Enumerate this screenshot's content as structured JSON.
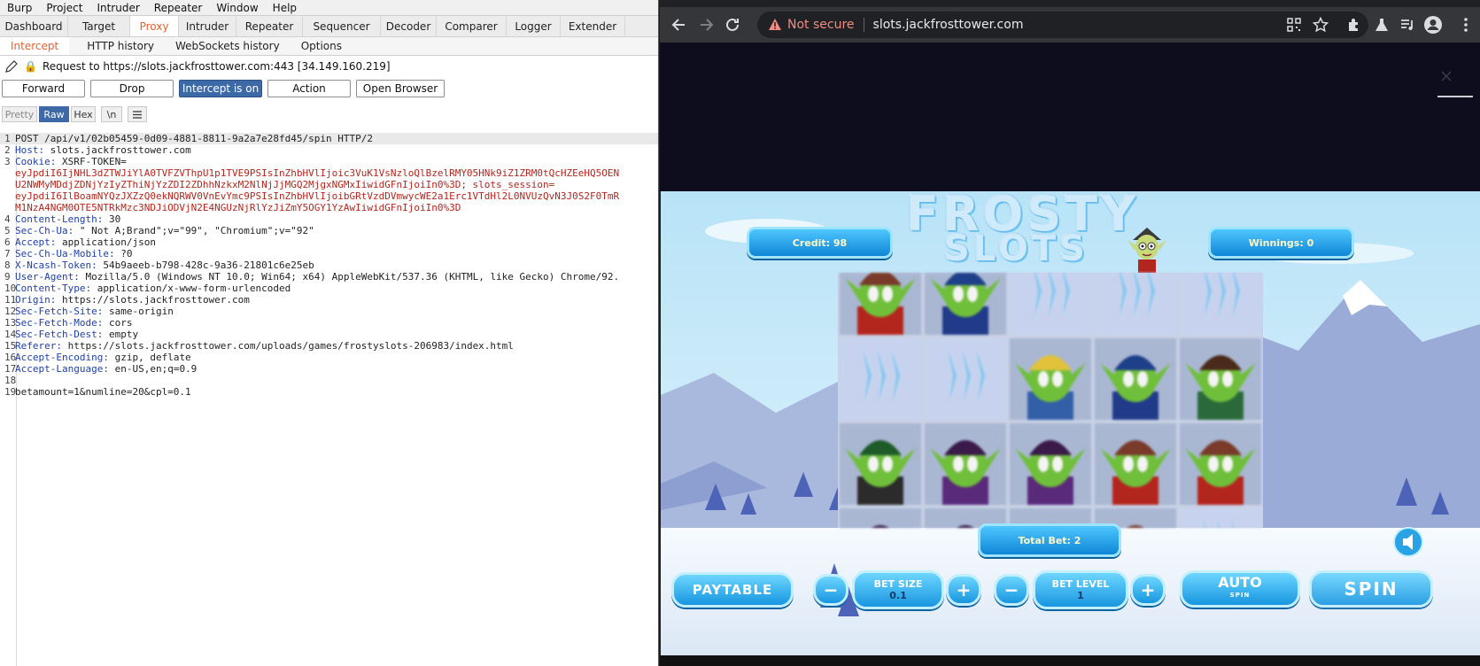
{
  "burp": {
    "menu": [
      "Burp",
      "Project",
      "Intruder",
      "Repeater",
      "Window",
      "Help"
    ],
    "tabs": [
      "Dashboard",
      "Target",
      "Proxy",
      "Intruder",
      "Repeater",
      "Sequencer",
      "Decoder",
      "Comparer",
      "Logger",
      "Extender"
    ],
    "active_tab": "Proxy",
    "subtabs": [
      "Intercept",
      "HTTP history",
      "WebSockets history",
      "Options"
    ],
    "active_subtab": "Intercept",
    "request_target": "Request to https://slots.jackfrosttower.com:443  [34.149.160.219]",
    "buttons": {
      "forward": "Forward",
      "drop": "Drop",
      "intercept": "Intercept is on",
      "action": "Action",
      "open_browser": "Open Browser"
    },
    "view": {
      "pretty": "Pretty",
      "raw": "Raw",
      "hex": "Hex",
      "newline": "\\n",
      "menu_icon": "hamburger-icon"
    },
    "request_lines": [
      {
        "n": "1",
        "k": "",
        "v": "POST /api/v1/02b05459-0d09-4881-8811-9a2a7e28fd45/spin HTTP/2"
      },
      {
        "n": "2",
        "k": "Host",
        "v": " slots.jackfrosttower.com"
      },
      {
        "n": "3",
        "k": "Cookie",
        "v": " XSRF-TOKEN="
      },
      {
        "n": "",
        "k": "",
        "v": "eyJpdiI6IjNHL3dZTWJiYlA0TVFZVThpU1p1TVE9PSIsInZhbHVlIjoic3VuK1VsNzloQlBzelRMY05HNk9iZ1ZRM0tQcHZEeHQ5OEN"
      },
      {
        "n": "",
        "k": "",
        "v": "U2NWMyMDdjZDNjYzIyZThiNjYzZDI2ZDhhNzkxM2NlNjJjMGQ2MjgxNGMxIiwidGFnIjoiIn0%3D; slots_session="
      },
      {
        "n": "",
        "k": "",
        "v": "eyJpdiI6IlBoamNYQzJXZzQ0ekNQRWV0VnEvYmc9PSIsInZhbHVlIjoibGRtVzdDVmwycWE2a1Erc1VTdHl2L0NVUzQvN3J0S2F0TmR"
      },
      {
        "n": "",
        "k": "",
        "v": "M1NzA4NGM0OTE5NTRkMzc3NDJiODVjN2E4NGUzNjRlYzJiZmY5OGY1YzAwIiwidGFnIjoiIn0%3D"
      },
      {
        "n": "4",
        "k": "Content-Length",
        "v": " 30"
      },
      {
        "n": "5",
        "k": "Sec-Ch-Ua",
        "v": " \" Not A;Brand\";v=\"99\", \"Chromium\";v=\"92\""
      },
      {
        "n": "6",
        "k": "Accept",
        "v": " application/json"
      },
      {
        "n": "7",
        "k": "Sec-Ch-Ua-Mobile",
        "v": " ?0"
      },
      {
        "n": "8",
        "k": "X-Ncash-Token",
        "v": " 54b9aeeb-b798-428c-9a36-21801c6e25eb"
      },
      {
        "n": "9",
        "k": "User-Agent",
        "v": " Mozilla/5.0 (Windows NT 10.0; Win64; x64) AppleWebKit/537.36 (KHTML, like Gecko) Chrome/92."
      },
      {
        "n": "10",
        "k": "Content-Type",
        "v": " application/x-www-form-urlencoded"
      },
      {
        "n": "11",
        "k": "Origin",
        "v": " https://slots.jackfrosttower.com"
      },
      {
        "n": "12",
        "k": "Sec-Fetch-Site",
        "v": " same-origin"
      },
      {
        "n": "13",
        "k": "Sec-Fetch-Mode",
        "v": " cors"
      },
      {
        "n": "14",
        "k": "Sec-Fetch-Dest",
        "v": " empty"
      },
      {
        "n": "15",
        "k": "Referer",
        "v": " https://slots.jackfrosttower.com/uploads/games/frostyslots-206983/index.html"
      },
      {
        "n": "16",
        "k": "Accept-Encoding",
        "v": " gzip, deflate"
      },
      {
        "n": "17",
        "k": "Accept-Language",
        "v": " en-US,en;q=0.9"
      },
      {
        "n": "18",
        "k": "",
        "v": ""
      },
      {
        "n": "19",
        "k": "",
        "v": "betamount=1&numline=20&cpl=0.1"
      }
    ]
  },
  "browser": {
    "security": "Not secure",
    "url": "slots.jackfrosttower.com",
    "game": {
      "title_line1": "FROSTY",
      "title_line2": "SLOTS",
      "credit": "Credit: 98",
      "winnings": "Winnings: 0",
      "total_bet": "Total Bet: 2",
      "paytable": "PAYTABLE",
      "bet_size_label": "BET SIZE",
      "bet_size_value": "0.1",
      "bet_level_label": "BET LEVEL",
      "bet_level_value": "1",
      "auto": "AUTO",
      "auto_sub": "SPIN",
      "spin": "SPIN",
      "minus": "−",
      "plus": "+"
    }
  }
}
